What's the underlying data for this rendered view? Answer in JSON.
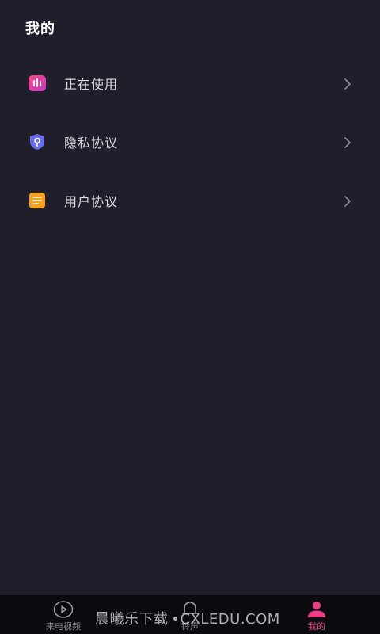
{
  "header": {
    "title": "我的"
  },
  "menu": {
    "items": [
      {
        "label": "正在使用",
        "icon": "equalizer-icon",
        "icon_color": "#e93f8a"
      },
      {
        "label": "隐私协议",
        "icon": "shield-key-icon",
        "icon_color": "#6a6cf0"
      },
      {
        "label": "用户协议",
        "icon": "document-lines-icon",
        "icon_color": "#f6a11b"
      }
    ]
  },
  "tabbar": {
    "tabs": [
      {
        "label": "来电视频",
        "icon": "play-circle-icon",
        "active": false
      },
      {
        "label": "铃声",
        "icon": "bell-icon",
        "active": false
      },
      {
        "label": "我的",
        "icon": "person-icon",
        "active": true
      }
    ],
    "active_color": "#ee3b86"
  },
  "watermark": {
    "text_cn": "晨曦乐下载",
    "text_domain": "CXLEDU.COM"
  },
  "colors": {
    "background": "#1f1f2b",
    "tabbar_bg": "#0b0b0f"
  }
}
